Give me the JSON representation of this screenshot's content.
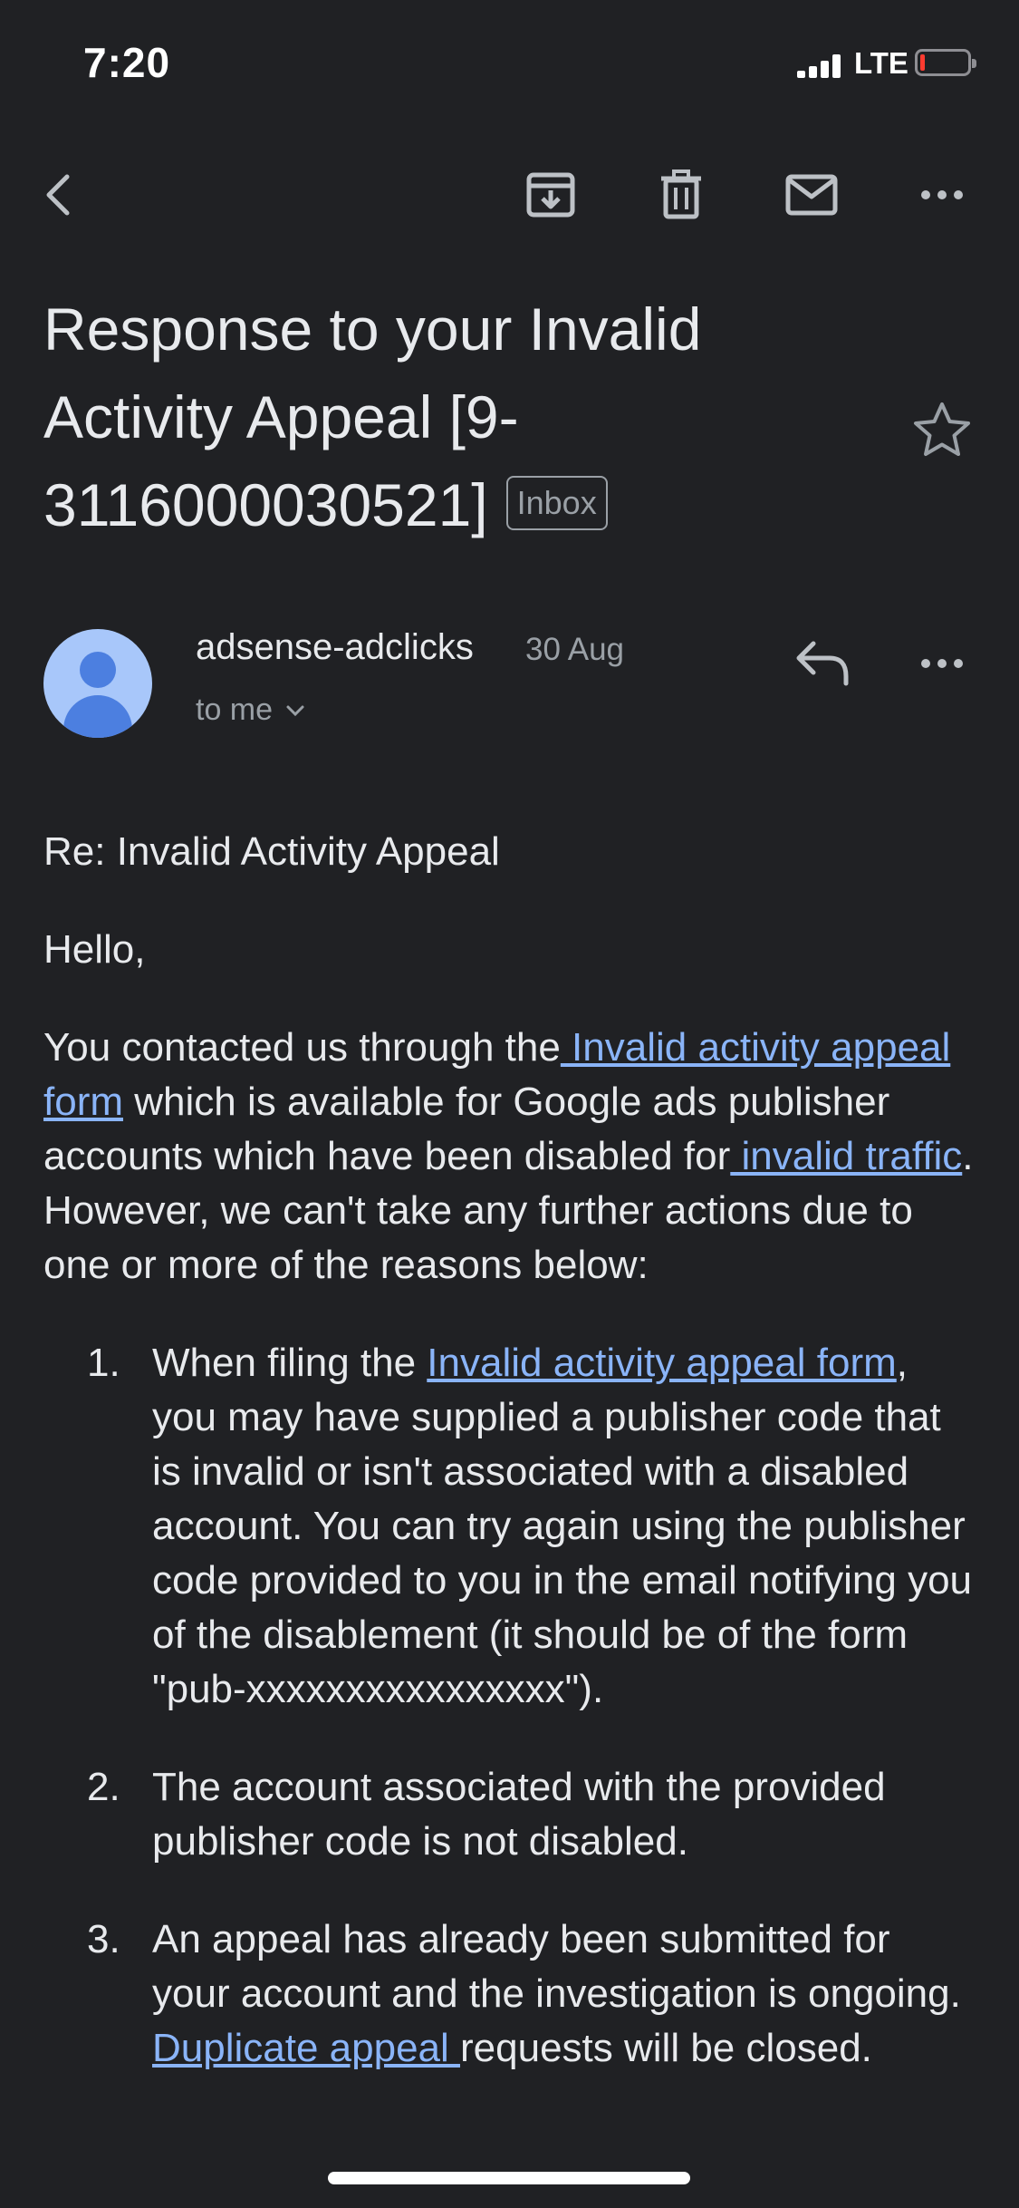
{
  "status_bar": {
    "time": "7:20",
    "network": "LTE",
    "icons": [
      "signal-icon",
      "battery-icon"
    ],
    "battery_color": "#ff3b30"
  },
  "toolbar": {
    "icons": [
      "back-icon",
      "archive-icon",
      "delete-icon",
      "mark-unread-icon",
      "more-icon"
    ]
  },
  "email": {
    "subject": "Response to your Invalid Activity Appeal [9-3116000030521]",
    "label": "Inbox",
    "sender": "adsense-adclicks",
    "date": "30 Aug",
    "recipient": "to me",
    "body": {
      "re_line": "Re: Invalid Activity Appeal",
      "greeting": "Hello,",
      "intro": {
        "t1": "You contacted us through the",
        "link1": " Invalid activity appeal form",
        "t2": " which is available for Google ads publisher accounts which have been disabled for",
        "link2": " invalid traffic",
        "t3": ". However, we can't take any further actions due to one or more of the reasons below:"
      },
      "reasons": [
        {
          "number": "1.",
          "t1": "When filing the ",
          "link": "Invalid activity appeal form",
          "t2": ", you may have supplied a publisher code that is invalid or isn't associated with a disabled account. You can try again using the publisher code provided to you in the email notifying you of the disablement (it should be of the form \"pub-xxxxxxxxxxxxxxxx\")."
        },
        {
          "number": "2.",
          "text": "The account associated with the provided publisher code is not disabled."
        },
        {
          "number": "3.",
          "t1": "An appeal has already been submitted for your account and the investigation is ongoing.",
          "link": " Duplicate appeal ",
          "t2": "requests will be closed."
        }
      ]
    }
  },
  "colors": {
    "background": "#202124",
    "link": "#8ab4f8",
    "avatar": "#a8c7fa",
    "avatar_figure": "#4c7fe0"
  }
}
